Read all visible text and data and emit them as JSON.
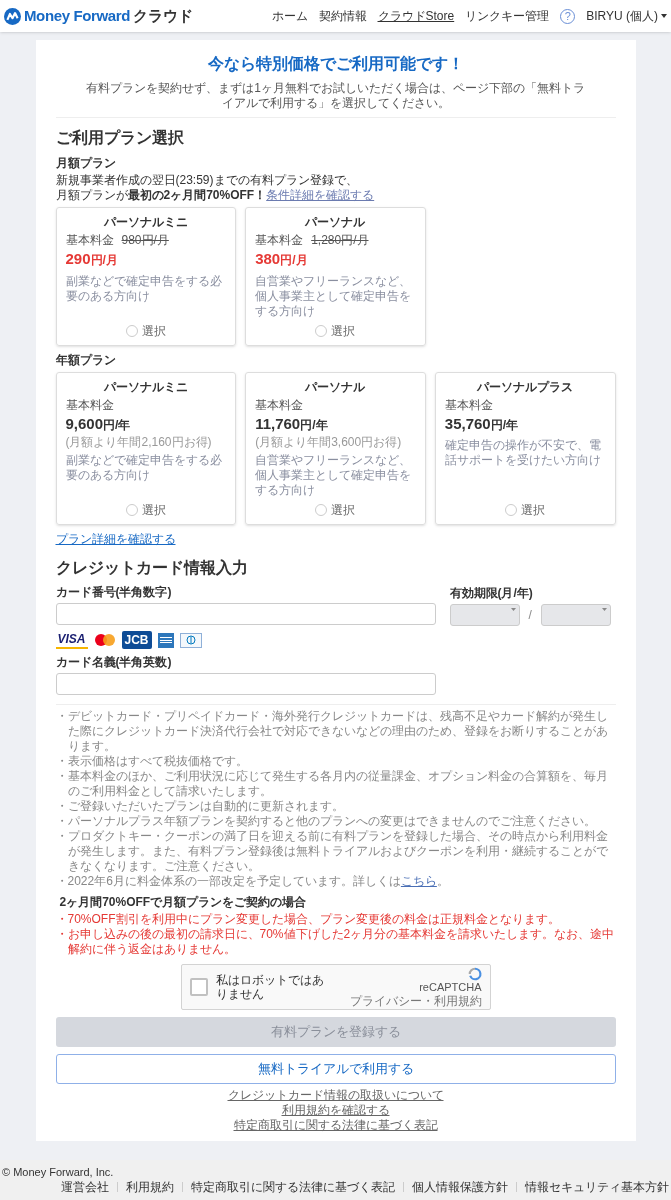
{
  "header": {
    "logo": "Money Forward",
    "logo_suffix": "クラウド",
    "nav": [
      {
        "label": "ホーム",
        "selected": false
      },
      {
        "label": "契約情報",
        "selected": false
      },
      {
        "label": "クラウドStore",
        "selected": true
      },
      {
        "label": "リンクキー管理",
        "selected": false
      }
    ],
    "help": "?",
    "user": "BIRYU (個人)"
  },
  "headline": "今なら特別価格でご利用可能です！",
  "intro": "有料プランを契約せず、まずは1ヶ月無料でお試しいただく場合は、ページ下部の「無料トライアルで利用する」を選択してください。",
  "plan_section": {
    "title": "ご利用プラン選択",
    "monthly": {
      "label": "月額プラン",
      "promo_lines": [
        "新規事業者作成の翌日(23:59)までの有料プラン登録で、",
        "月額プランが**最初の2ヶ月間70%OFF！**"
      ],
      "promo_link": "条件詳細を確認する",
      "plans": [
        {
          "name": "パーソナルミニ",
          "base_label": "基本料金",
          "old_price": "980円/月",
          "price": "290",
          "unit": "円/月",
          "description": "副業などで確定申告をする必要のある方向け",
          "radio_label": "選択",
          "selected": false
        },
        {
          "name": "パーソナル",
          "base_label": "基本料金",
          "old_price": "1,280円/月",
          "price": "380",
          "unit": "円/月",
          "description": "自営業やフリーランスなど、個人事業主として確定申告をする方向け",
          "radio_label": "選択",
          "selected": false
        }
      ]
    },
    "annual": {
      "label": "年額プラン",
      "plans": [
        {
          "name": "パーソナルミニ",
          "base_label": "基本料金",
          "price": "9,600",
          "unit": "円/年",
          "saving": "(月額より年間2,160円お得)",
          "description": "副業などで確定申告をする必要のある方向け",
          "radio_label": "選択",
          "selected": false
        },
        {
          "name": "パーソナル",
          "base_label": "基本料金",
          "price": "11,760",
          "unit": "円/年",
          "saving": "(月額より年間3,600円お得)",
          "description": "自営業やフリーランスなど、個人事業主として確定申告をする方向け",
          "radio_label": "選択",
          "selected": false
        },
        {
          "name": "パーソナルプラス",
          "base_label": "基本料金",
          "price": "35,760",
          "unit": "円/年",
          "description": "確定申告の操作が不安で、電話サポートを受けたい方向け",
          "radio_label": "選択",
          "selected": false
        }
      ]
    },
    "detail_link": "プラン詳細を確認する"
  },
  "card_section": {
    "title": "クレジットカード情報入力",
    "number_label": "カード番号(半角数字)",
    "expiry_label": "有効期限(月/年)",
    "expiry_separator": "/",
    "brands": [
      {
        "kind": "visa",
        "text": "VISA"
      },
      {
        "kind": "mastercard"
      },
      {
        "kind": "jcb",
        "text": "JCB"
      },
      {
        "kind": "amex"
      },
      {
        "kind": "diners"
      }
    ],
    "name_label": "カード名義(半角英数)"
  },
  "notes": [
    {
      "text": "・デビットカード・プリペイドカード・海外発行クレジットカードは、残高不足やカード解約が発生した際にクレジットカード決済代行会社で対応できないなどの理由のため、登録をお断りすることがあります。"
    },
    {
      "text": "・表示価格はすべて税抜価格です。"
    },
    {
      "text": "・基本料金のほか、ご利用状況に応じて発生する各月内の従量課金、オプション料金の合算額を、毎月のご利用料金として請求いたします。"
    },
    {
      "text": "・ご登録いただいたプランは自動的に更新されます。"
    },
    {
      "text": "・パーソナルプラス年額プランを契約すると他のプランへの変更はできませんのでご注意ください。"
    },
    {
      "text": "・プロダクトキー・クーポンの満了日を迎える前に有料プランを登録した場合、その時点から利用料金が発生します。また、有料プラン登録後は無料トライアルおよびクーポンを利用・継続することができなくなります。ご注意ください。"
    },
    {
      "text": "・2022年6月に料金体系の一部改定を予定しています。詳しくは",
      "link": "こちら",
      "after": "。"
    }
  ],
  "discount": {
    "title": "2ヶ月間70%OFFで月額プランをご契約の場合",
    "items": [
      "・70%OFF割引を利用中にプラン変更した場合、プラン変更後の料金は正規料金となります。",
      "・お申し込みの後の最初の請求日に、70%値下げした2ヶ月分の基本料金を請求いたします。なお、途中解約に伴う返金はありません。"
    ]
  },
  "captcha": {
    "label": "私はロボットではありません",
    "checked": false,
    "brand": "reCAPTCHA",
    "links": "プライバシー・利用規約"
  },
  "buttons": [
    {
      "label": "有料プランを登録する",
      "kind": "primary",
      "disabled": true
    },
    {
      "label": "無料トライアルで利用する",
      "kind": "secondary",
      "disabled": false
    }
  ],
  "links": [
    "クレジットカード情報の取扱いについて",
    "利用規約を確認する",
    "特定商取引に関する法律に基づく表記"
  ],
  "footer": {
    "copyright": "© Money Forward, Inc.",
    "links": [
      "運営会社",
      "利用規約",
      "特定商取引に関する法律に基づく表記",
      "個人情報保護方針",
      "情報セキュリティ基本方針"
    ]
  }
}
